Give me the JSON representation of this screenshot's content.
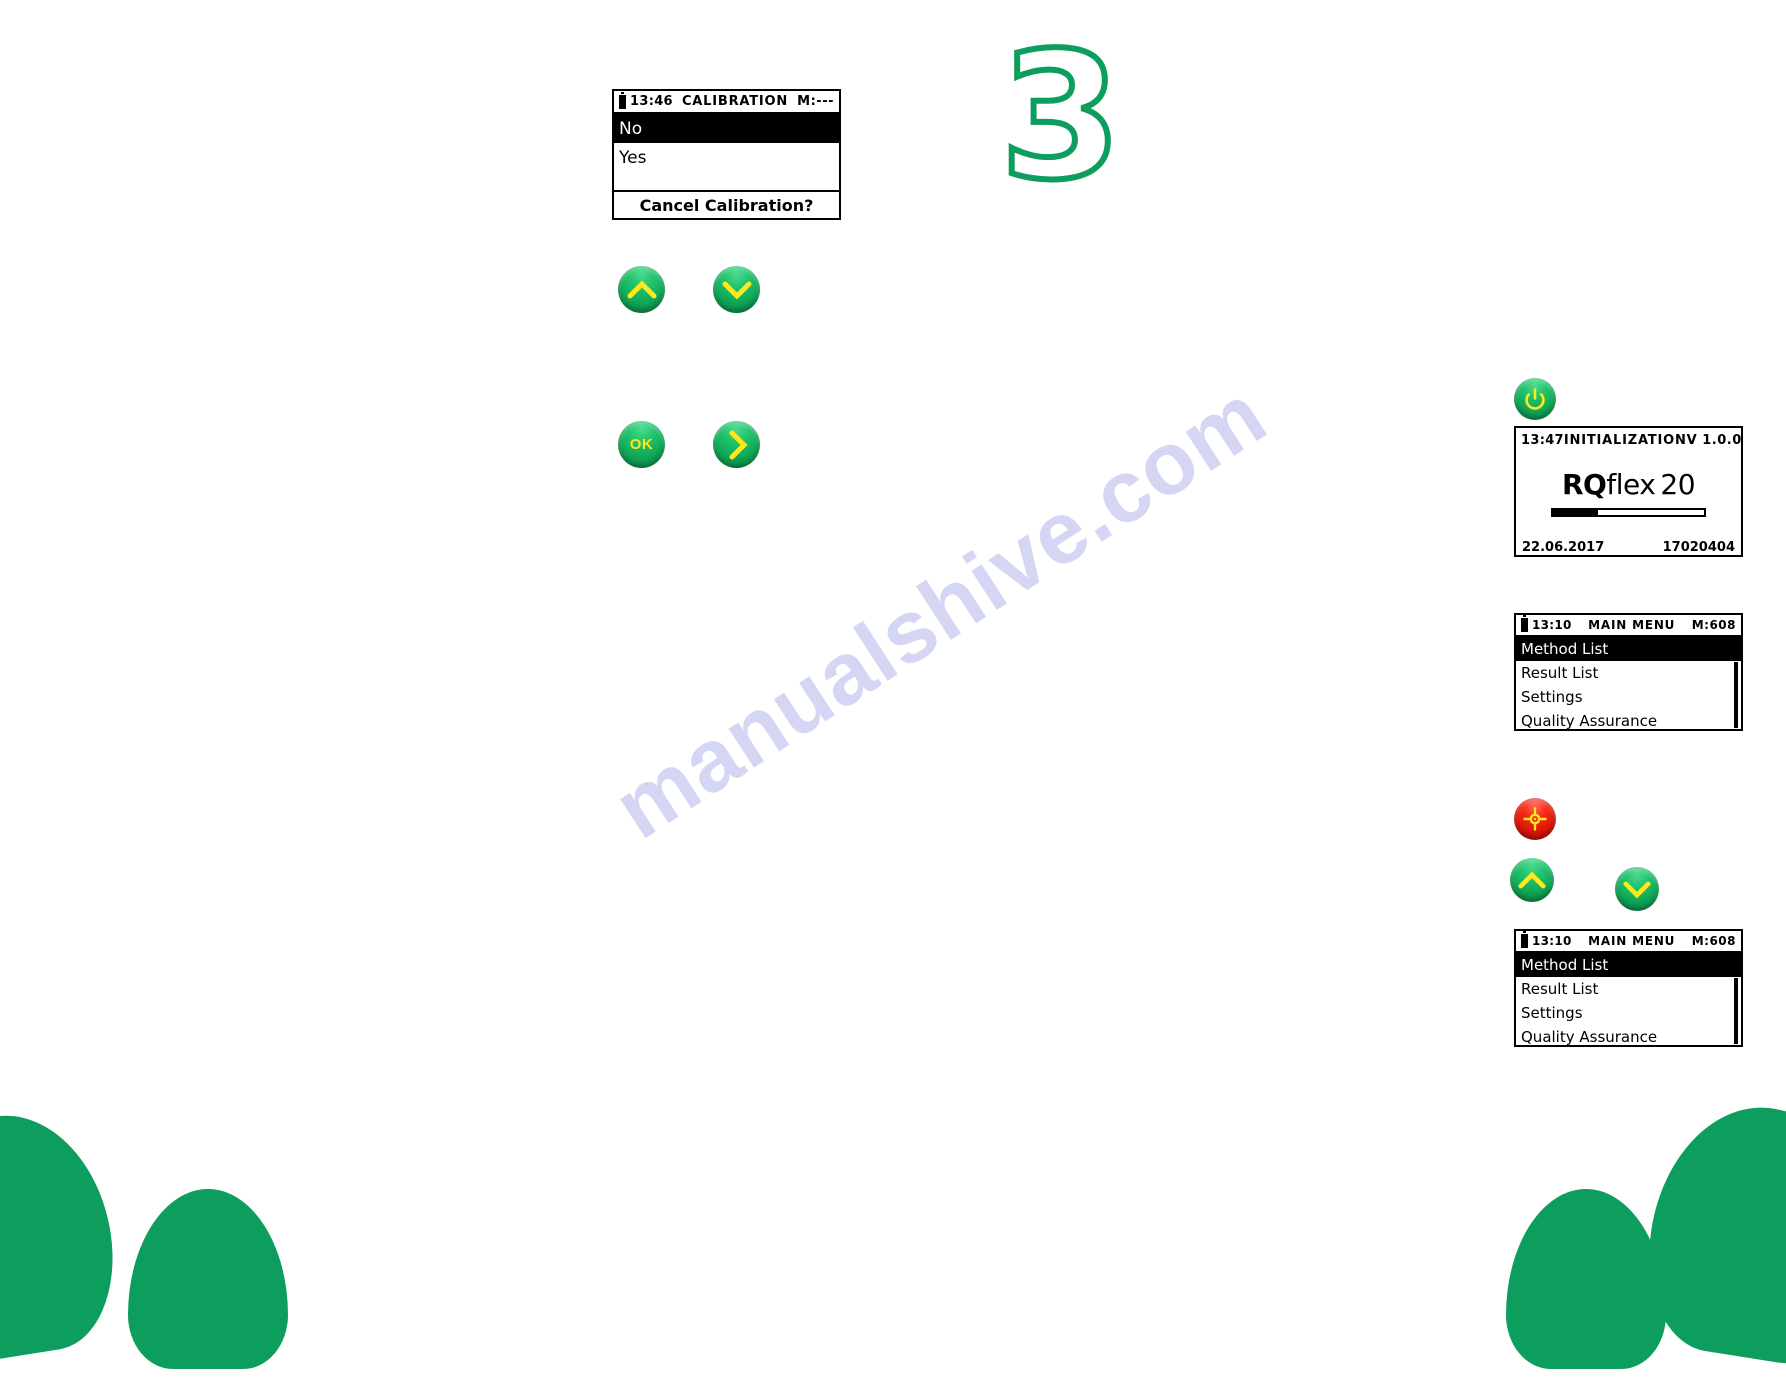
{
  "page": {
    "step_number": "3",
    "watermark": "manualshive.com",
    "accent_green": "#0d9e5e",
    "button_yellow": "#ffe81a",
    "button_red": "#e01508"
  },
  "screens": {
    "calibration": {
      "header": {
        "time": "13:46",
        "title": "CALIBRATION",
        "memory": "M:---"
      },
      "items": [
        {
          "label": "No",
          "selected": true
        },
        {
          "label": "Yes",
          "selected": false
        }
      ],
      "footer": "Cancel Calibration?"
    },
    "initialization": {
      "header": {
        "time": "13:47",
        "title": "INITIALIZATION",
        "version": "V 1.0.0"
      },
      "logo_left": "RQ",
      "logo_mid": "flex",
      "logo_right": "20",
      "progress_percent": 30,
      "date": "22.06.2017",
      "serial": "17020404"
    },
    "main_menu": {
      "header": {
        "time": "13:10",
        "title": "MAIN MENU",
        "memory": "M:608"
      },
      "items": [
        {
          "label": "Method List",
          "selected": true
        },
        {
          "label": "Result List",
          "selected": false
        },
        {
          "label": "Settings",
          "selected": false
        },
        {
          "label": "Quality Assurance",
          "selected": false
        }
      ]
    }
  },
  "buttons": {
    "up": {
      "icon": "chevron-up-icon"
    },
    "down": {
      "icon": "chevron-down-icon"
    },
    "ok": {
      "label": "OK"
    },
    "right": {
      "icon": "chevron-right-icon"
    },
    "power": {
      "icon": "power-icon"
    },
    "measure": {
      "icon": "measure-crosshair-icon"
    }
  }
}
